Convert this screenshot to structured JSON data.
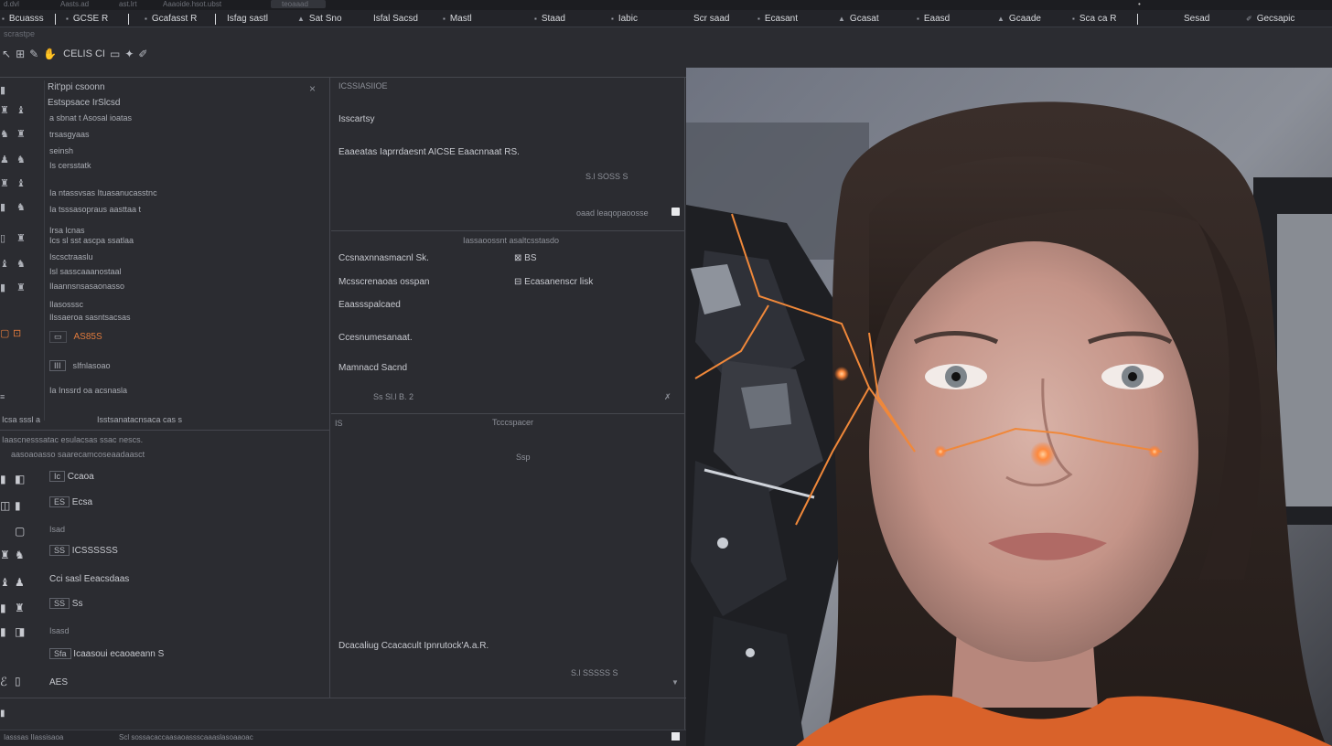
{
  "top_strip": {
    "items": [
      "d.dvl",
      "Aasts.ad",
      "ast.lrt",
      "Aaaoide.hsot.ubst",
      "teoaaad"
    ]
  },
  "menubar": {
    "items": [
      {
        "glyph": "▪",
        "label": "Bcuasss"
      },
      {
        "glyph": "▪",
        "label": "GCSE R"
      },
      {
        "glyph": "▪",
        "label": "Gcafasst R"
      },
      {
        "glyph": "",
        "label": "Isfag sastl"
      },
      {
        "glyph": "▲",
        "label": "Sat Sno"
      },
      {
        "glyph": "",
        "label": "Isfal Sacsd"
      },
      {
        "glyph": "▪",
        "label": "Mastl"
      },
      {
        "glyph": "▪",
        "label": "Staad"
      },
      {
        "glyph": "▪",
        "label": "Iabic"
      },
      {
        "glyph": "",
        "label": "Scr saad"
      },
      {
        "glyph": "▪",
        "label": "Ecasant"
      },
      {
        "glyph": "▲",
        "label": "Gcasat"
      },
      {
        "glyph": "▪",
        "label": "Eaasd"
      },
      {
        "glyph": "▲",
        "label": "Gcaade"
      },
      {
        "glyph": "▪",
        "label": "Sca ca R"
      },
      {
        "glyph": "",
        "label": "Sesad"
      },
      {
        "glyph": "",
        "label": "Gecsapic"
      }
    ]
  },
  "sub_strip": {
    "label": "scrastpe"
  },
  "toolbar": {
    "icons": [
      "pointer-icon",
      "grid-icon",
      "brush-icon",
      "hand-icon",
      "frame-icon",
      "star-icon",
      "pen-icon"
    ],
    "glyphs": [
      "↖",
      "⊞",
      "✎",
      "✋",
      "▭",
      "✦",
      "✐"
    ],
    "label": "CELIS CI"
  },
  "left_panel": {
    "title": "Rit'ppi csoonn",
    "subtitle": "Estspsace IrSlcsd",
    "close": "×",
    "rows": [
      "a sbnat t Asosal ioatas",
      "trsasgyaas",
      "seinsh",
      "Is cersstatk",
      "Ia ntassvsas Ituasanucasstnc",
      "Ia tsssasopraus aasttaa t",
      "Irsa lcnas",
      "Ics sl sst ascpa ssatlaa",
      "Iscsctraaslu",
      "Isl sasscaaanostaal",
      "Ilaannsnsasaonasso",
      "Ilasosssc",
      "Ilssaeroa sasntsacsas"
    ],
    "orange_row": "AS85S",
    "boxed_row": "sIfnlasoao",
    "dim_row": "Ia Inssrd oa acsnasla",
    "footer_left": "Icsa sssl a",
    "footer_right": "Isstsanatacnsaca cas s"
  },
  "mid_top": {
    "header": "ICSSIASIIOE",
    "line1": "Isscartsy",
    "line2": "Eaaeatas Iaprrdaesnt AICSE Eaacnnaat RS.",
    "value": "S.l SOSS S",
    "bottom": "oaad leaqopaoosse"
  },
  "mid_mid": {
    "header": "Iassaoossnt asaltcsstasdo",
    "row1_label": "Ccsnaxnnasmacnl Sk.",
    "row1_value": "BS",
    "row2_label": "Mcsscrenaoas osspan",
    "row2_value": "Ecasanenscr lisk",
    "row3": "Eaassspalcaed",
    "row4": "Ccesnumesanaat.",
    "row5": "Mamnacd Sacnd",
    "value": "Ss Sl.l B. 2"
  },
  "mid_bot": {
    "corner": "IS",
    "header": "Tcccspacer",
    "sub": "Ssp",
    "footer": "Dcacaliug Ccacacult Ipnrutock'A.a.R.",
    "value": "S.l SSSSS S"
  },
  "left_bottom": {
    "hdr1": "Iaascnesssatac esulacsas ssac nescs.",
    "hdr2": "aasoaoasso saarecamcoseaadaasct",
    "items": [
      {
        "kind": "boxed",
        "a": "Ic",
        "b": "Ccaoa"
      },
      {
        "kind": "boxed",
        "a": "ES",
        "b": "Ecsa"
      },
      {
        "kind": "plain",
        "a": "Isad",
        "b": ""
      },
      {
        "kind": "boxed",
        "a": "SS",
        "b": "ICSSSSSS"
      },
      {
        "kind": "plain",
        "a": "Cci sasl Eeacsdaas",
        "b": ""
      },
      {
        "kind": "boxed",
        "a": "SS",
        "b": "Ss"
      },
      {
        "kind": "plain",
        "a": "Isasd",
        "b": ""
      },
      {
        "kind": "boxed",
        "a": "Sfa",
        "b": "Icaasoui ecaoaeann S"
      },
      {
        "kind": "plain",
        "a": "AES",
        "b": ""
      }
    ]
  },
  "status_bar": {
    "left": "Iasssas IIassisaoa",
    "right": "Scl sossacaccaasaoassscaaaslasoaaoac"
  },
  "colors": {
    "background": "#2b2c31",
    "panel_border": "#45474e",
    "accent": "#e07a3c",
    "text": "#c9cbd1"
  },
  "viewport": {
    "subject": "portrait",
    "highlight": "orange-circuit-lines"
  }
}
